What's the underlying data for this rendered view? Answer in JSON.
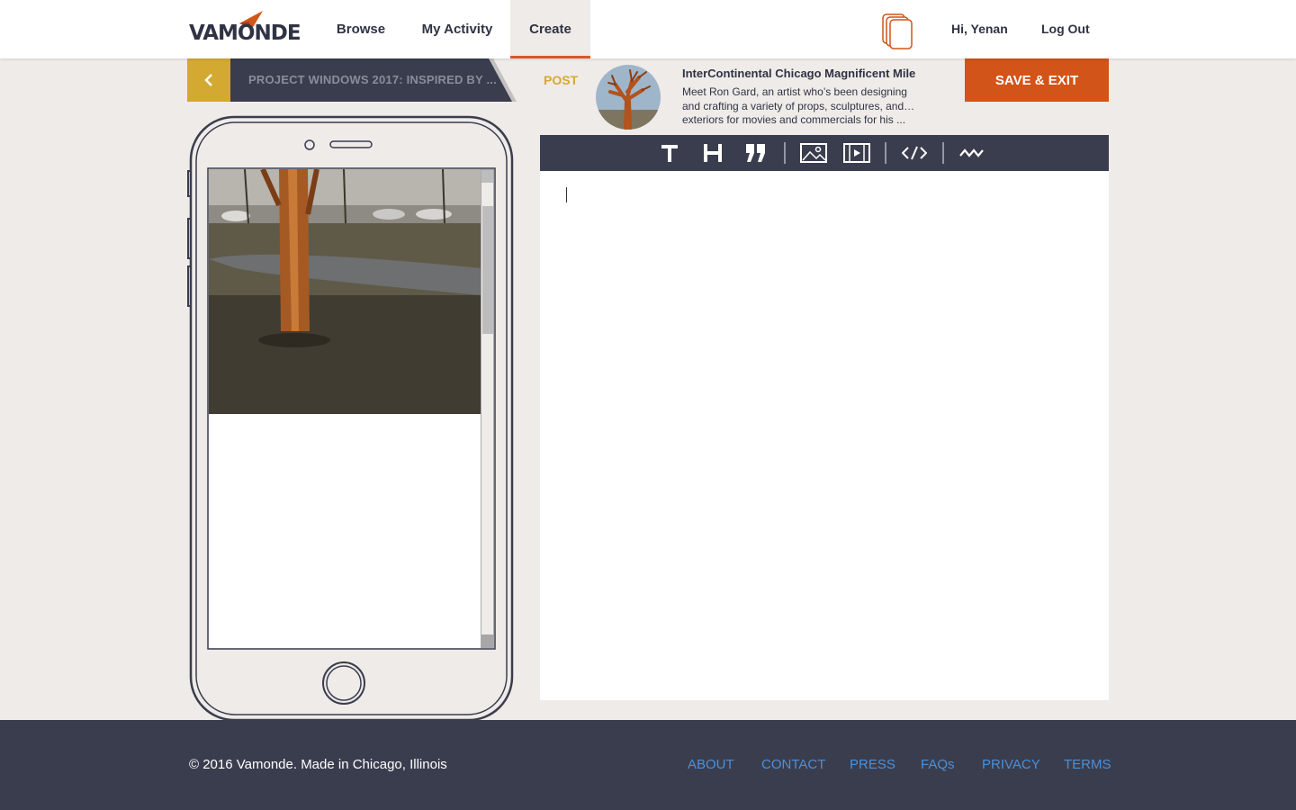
{
  "brand": {
    "name": "VAMONDE",
    "accent": "#d25419",
    "gold": "#d4a932",
    "navy": "#3a3d4e"
  },
  "nav": {
    "items": [
      "Browse",
      "My Activity",
      "Create"
    ],
    "active": "Create"
  },
  "user": {
    "greeting": "Hi, Yenan",
    "logout": "Log Out",
    "icon": "documents-icon"
  },
  "project": {
    "title": "PROJECT WINDOWS 2017: INSPIRED BY ...",
    "back_icon": "chevron-left-icon"
  },
  "post": {
    "label": "POST",
    "title": "InterContinental Chicago Magnificent Mile",
    "description_line1": "Meet Ron Gard, an artist who’s been designing",
    "description_line2": "and crafting a variety of props, sculptures, and…",
    "description_line3": "exteriors for movies and commercials for his ..."
  },
  "actions": {
    "save_exit": "SAVE & EXIT"
  },
  "toolbar": {
    "tools": [
      "text-icon",
      "heading-icon",
      "quote-icon",
      "image-icon",
      "video-icon",
      "embed-code-icon",
      "divider-icon"
    ]
  },
  "footer": {
    "copyright": "© 2016 Vamonde. Made in Chicago, Illinois",
    "links": [
      "ABOUT",
      "CONTACT",
      "PRESS",
      "FAQs",
      "PRIVACY",
      "TERMS"
    ]
  }
}
